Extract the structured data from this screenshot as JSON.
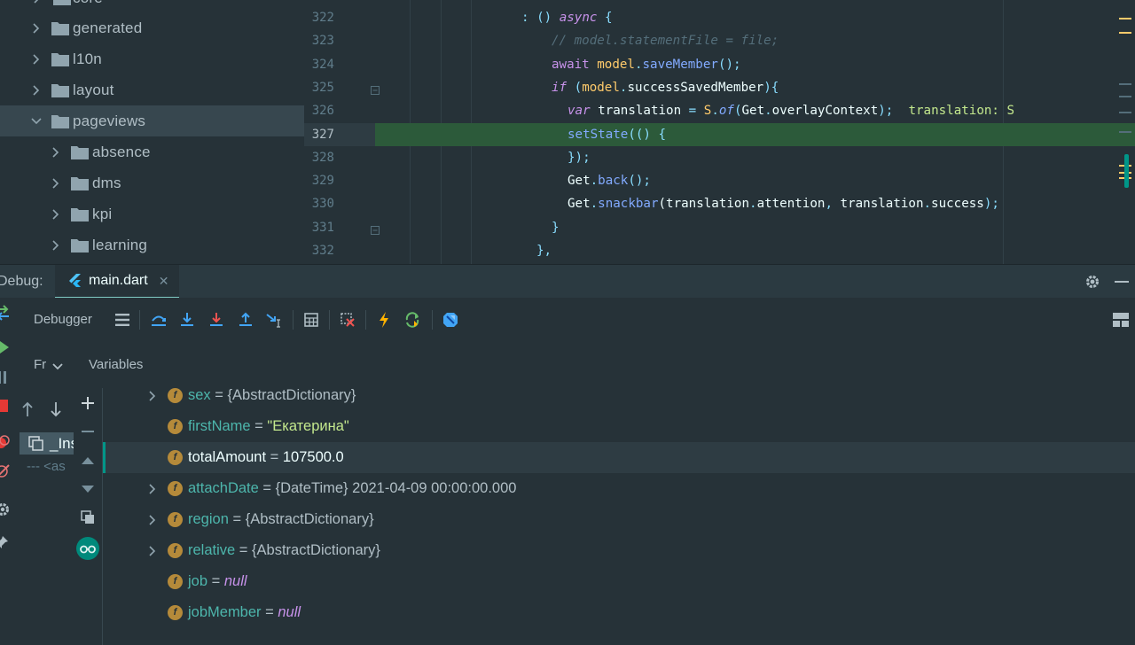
{
  "project_tree": {
    "partial_top_label": "core",
    "items": [
      {
        "label": "generated",
        "depth": 1,
        "expanded": false
      },
      {
        "label": "l10n",
        "depth": 1,
        "expanded": false
      },
      {
        "label": "layout",
        "depth": 1,
        "expanded": false
      },
      {
        "label": "pageviews",
        "depth": 1,
        "expanded": true,
        "selected": true
      },
      {
        "label": "absence",
        "depth": 2,
        "expanded": false
      },
      {
        "label": "dms",
        "depth": 2,
        "expanded": false
      },
      {
        "label": "kpi",
        "depth": 2,
        "expanded": false
      },
      {
        "label": "learning",
        "depth": 2,
        "expanded": false
      }
    ]
  },
  "editor": {
    "current_line": 327,
    "lines": [
      {
        "n": "322",
        "tokens": [
          {
            "t": ": () ",
            "c": "p"
          },
          {
            "t": "async",
            "c": "k"
          },
          {
            "t": " {",
            "c": "p"
          }
        ]
      },
      {
        "n": "323",
        "tokens": [
          {
            "t": "// model.statementFile = file;",
            "c": "cm"
          }
        ]
      },
      {
        "n": "324",
        "tokens": [
          {
            "t": "await ",
            "c": "kw"
          },
          {
            "t": "model",
            "c": "o"
          },
          {
            "t": ".",
            "c": "p"
          },
          {
            "t": "saveMember",
            "c": "f"
          },
          {
            "t": "();",
            "c": "p"
          }
        ]
      },
      {
        "n": "325",
        "tokens": [
          {
            "t": "if",
            "c": "k"
          },
          {
            "t": " (",
            "c": "p"
          },
          {
            "t": "model",
            "c": "o"
          },
          {
            "t": ".",
            "c": "p"
          },
          {
            "t": "successSavedMember",
            "c": "w"
          },
          {
            "t": "){",
            "c": "p"
          }
        ]
      },
      {
        "n": "326",
        "tokens": [
          {
            "t": "var",
            "c": "k"
          },
          {
            "t": " translation ",
            "c": "w"
          },
          {
            "t": "= ",
            "c": "p"
          },
          {
            "t": "S",
            "c": "y"
          },
          {
            "t": ".",
            "c": "p"
          },
          {
            "t": "of",
            "c": "kf"
          },
          {
            "t": "(",
            "c": "p"
          },
          {
            "t": "Get",
            "c": "w"
          },
          {
            "t": ".",
            "c": "p"
          },
          {
            "t": "overlayContext",
            "c": "w"
          },
          {
            "t": ");",
            "c": "p"
          },
          {
            "t": "  translation: S",
            "c": "inlay"
          }
        ]
      },
      {
        "n": "327",
        "tokens": [
          {
            "t": "setState",
            "c": "f"
          },
          {
            "t": "(() {",
            "c": "p"
          }
        ]
      },
      {
        "n": "328",
        "tokens": [
          {
            "t": "});",
            "c": "p"
          }
        ]
      },
      {
        "n": "329",
        "tokens": [
          {
            "t": "Get",
            "c": "w"
          },
          {
            "t": ".",
            "c": "p"
          },
          {
            "t": "back",
            "c": "f"
          },
          {
            "t": "();",
            "c": "p"
          }
        ]
      },
      {
        "n": "330",
        "tokens": [
          {
            "t": "Get",
            "c": "w"
          },
          {
            "t": ".",
            "c": "p"
          },
          {
            "t": "snackbar",
            "c": "f"
          },
          {
            "t": "(translation",
            "c": "w"
          },
          {
            "t": ".",
            "c": "p"
          },
          {
            "t": "attention",
            "c": "w"
          },
          {
            "t": ", ",
            "c": "p"
          },
          {
            "t": "translation",
            "c": "w"
          },
          {
            "t": ".",
            "c": "p"
          },
          {
            "t": "success",
            "c": "w"
          },
          {
            "t": ");",
            "c": "p"
          }
        ]
      },
      {
        "n": "331",
        "tokens": [
          {
            "t": "}",
            "c": "p"
          }
        ]
      },
      {
        "n": "332",
        "tokens": [
          {
            "t": "},",
            "c": "p"
          }
        ]
      }
    ]
  },
  "debug": {
    "title": "Debug:",
    "tab_label": "main.dart",
    "debugger_label": "Debugger",
    "frames_label": "Fr",
    "variables_label": "Variables",
    "frame_selected": "_Ins",
    "frame_async": "--- <as"
  },
  "variables": [
    {
      "name": "sex",
      "value": "{AbstractDictionary}",
      "type": "plain",
      "expandable": true
    },
    {
      "name": "firstName",
      "value": "\"Екатерина\"",
      "type": "string",
      "expandable": false
    },
    {
      "name": "totalAmount",
      "value": "107500.0",
      "type": "plain",
      "expandable": false,
      "selected": true
    },
    {
      "name": "attachDate",
      "value": "{DateTime} 2021-04-09 00:00:00.000",
      "type": "plain",
      "expandable": true
    },
    {
      "name": "region",
      "value": "{AbstractDictionary}",
      "type": "plain",
      "expandable": true
    },
    {
      "name": "relative",
      "value": "{AbstractDictionary}",
      "type": "plain",
      "expandable": true
    },
    {
      "name": "job",
      "value": "null",
      "type": "null",
      "expandable": false
    },
    {
      "name": "jobMember",
      "value": "null",
      "type": "null",
      "expandable": false
    }
  ],
  "colors": {
    "background": "#263238",
    "accent": "#80cbc4",
    "exec_line": "#2c5a3a",
    "field_badge": "#b58a3a"
  }
}
